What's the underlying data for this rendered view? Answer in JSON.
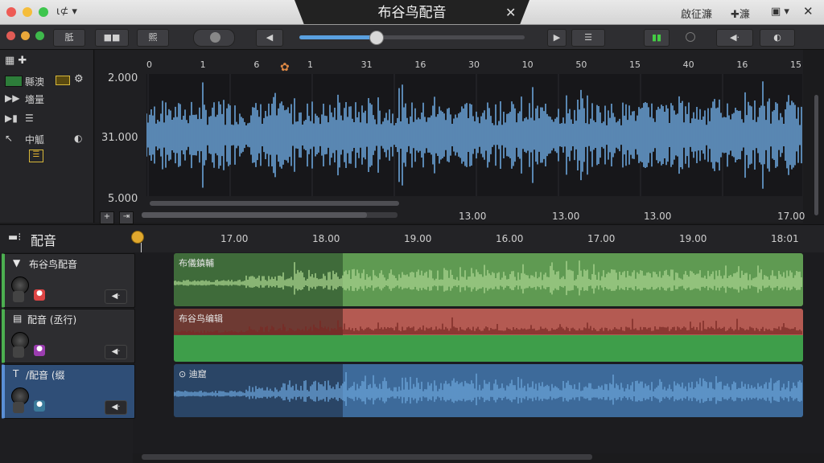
{
  "window": {
    "title": "布谷鸟配音",
    "close_tab": "✕",
    "right_menu": [
      "啟征濂",
      "✚濂",
      "▣ ▾"
    ],
    "close_window": "✕",
    "left_menu": "ι⊄ ▾"
  },
  "toolbar": {
    "btn1": "胝",
    "btn2": "■■",
    "btn3": "熙",
    "btn_list": "☰",
    "btn_dial": "◐"
  },
  "left_panel": {
    "rows": [
      "縣澳",
      "墻量",
      "",
      "中觚"
    ]
  },
  "overview": {
    "y_labels": [
      "2.000",
      "31.000",
      "5.000"
    ],
    "top_ticks": [
      "0",
      "1",
      "6",
      "1",
      "31",
      "16",
      "30",
      "10",
      "50",
      "15",
      "40",
      "16",
      "15"
    ],
    "bottom_ticks": [
      "13.00",
      "13.00",
      "13.00",
      "17.00"
    ],
    "level": 0.34
  },
  "tracks_header": {
    "title": "配音",
    "ruler": [
      "17.00",
      "18.00",
      "19.00",
      "16.00",
      "17.00",
      "19.00",
      "18:01"
    ]
  },
  "tracks": [
    {
      "name": "布谷鸟配音",
      "clip_label": "布儀鎮輔",
      "colors": {
        "a": "#3f6b3a",
        "b": "#5f9a52",
        "wave": "#a9d38e",
        "accent": "#4caf50"
      }
    },
    {
      "name": "配音 (丞行)",
      "clip_label": "布谷鸟编辑",
      "colors": {
        "a": "#6e3a33",
        "b": "#b45a52",
        "wave": "#7a2a25",
        "accent": "#4caf50"
      }
    },
    {
      "name": "/配音 (缀",
      "clip_label": "⊙ 迪窟",
      "colors": {
        "a": "#2a4566",
        "b": "#3d6a9a",
        "wave": "#6aa3d8",
        "accent": "#5a8fd6"
      }
    }
  ],
  "colors": {
    "wave_overview": "#6aa3d8",
    "playhead": "#e0a82e"
  }
}
